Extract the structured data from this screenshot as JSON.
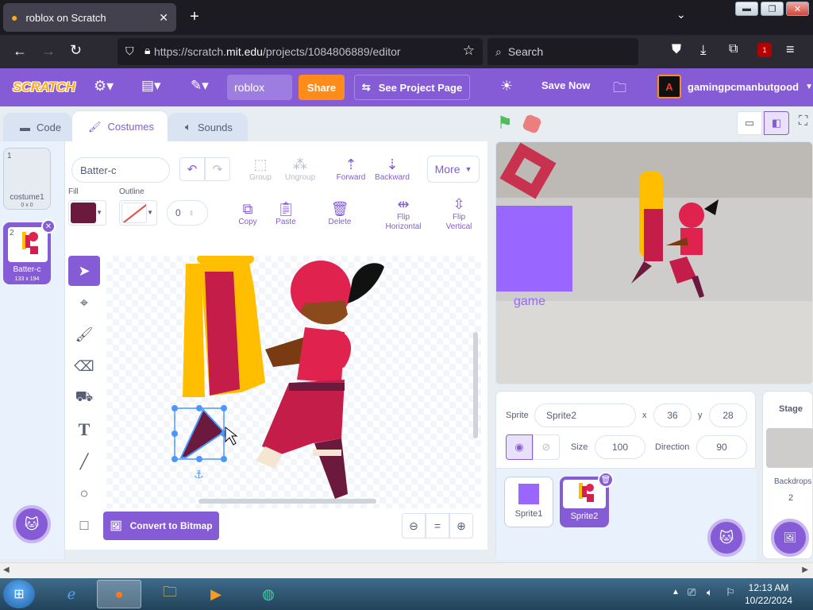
{
  "browser": {
    "tab_title": "roblox on Scratch",
    "url_prefix": "https://scratch.",
    "url_domain": "mit.edu",
    "url_path": "/projects/1084806889/editor",
    "search_placeholder": "Search",
    "ext_badge": "1"
  },
  "menubar": {
    "logo": "SCRATCH",
    "project_title": "roblox",
    "share": "Share",
    "see_project_page": "See Project Page",
    "save_now": "Save Now",
    "username": "gamingpcmanbutgood",
    "accent": "#855cd6"
  },
  "tabs": {
    "code": "Code",
    "costumes": "Costumes",
    "sounds": "Sounds"
  },
  "costumes": [
    {
      "num": "1",
      "name": "costume1",
      "size": "0 x 0"
    },
    {
      "num": "2",
      "name": "Batter-c",
      "size": "133 x 194"
    }
  ],
  "editor": {
    "costume_name": "Batter-c",
    "fill_label": "Fill",
    "outline_label": "Outline",
    "outline_width": "0",
    "group": "Group",
    "ungroup": "Ungroup",
    "forward": "Forward",
    "backward": "Backward",
    "more": "More",
    "copy": "Copy",
    "paste": "Paste",
    "delete": "Delete",
    "flip_h": "Flip Horizontal",
    "flip_v": "Flip Vertical",
    "convert": "Convert to Bitmap",
    "zoom_reset": "="
  },
  "stage": {
    "text": "game"
  },
  "sprite": {
    "label": "Sprite",
    "name": "Sprite2",
    "x_label": "x",
    "x": "36",
    "y_label": "y",
    "y": "28",
    "size_label": "Size",
    "size": "100",
    "direction_label": "Direction",
    "direction": "90",
    "list": [
      "Sprite1",
      "Sprite2"
    ]
  },
  "stage_panel": {
    "title": "Stage",
    "backdrops_label": "Backdrops",
    "backdrops_count": "2"
  },
  "taskbar": {
    "time": "12:13 AM",
    "date": "10/22/2024"
  }
}
